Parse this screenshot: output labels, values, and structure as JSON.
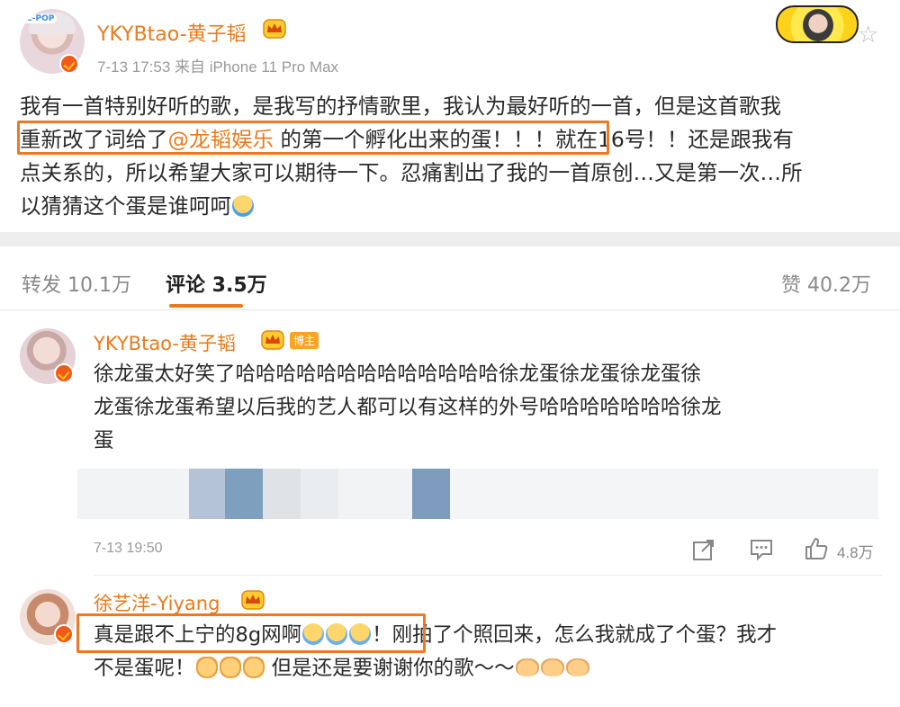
{
  "post": {
    "author": "YKYBtao-黄子韬",
    "meta": "7-13 17:53  来自 iPhone 11 Pro Max",
    "avatar_label": "C-POP",
    "lines": [
      "我有一首特别好听的歌，是我写的抒情歌里，我认为最好听的一首，但是这首歌我",
      "点关系的，所以希望大家可以期待一下。忍痛割出了我的一首原创…又是第一次…所",
      "以猜猜这个蛋是谁呵呵"
    ],
    "line2_before": "重新改了词给了",
    "line2_mention": "@龙韬娱乐",
    "line2_after": " 的第一个孵化出来的蛋！！！就在16号！！还是跟我有"
  },
  "tabs": {
    "repost": "转发 10.1万",
    "comments": "评论 3.5万",
    "likes": "赞 40.2万"
  },
  "comments": [
    {
      "author": "YKYBtao-黄子韬",
      "tag": "博主",
      "lines": [
        "徐龙蛋太好笑了哈哈哈哈哈哈哈哈哈哈哈哈哈徐龙蛋徐龙蛋徐龙蛋徐",
        "龙蛋徐龙蛋希望以后我的艺人都可以有这样的外号哈哈哈哈哈哈哈徐龙",
        "蛋"
      ],
      "time": "7-13 19:50",
      "likes": "4.8万"
    },
    {
      "author": "徐艺洋-Yiyang",
      "line1_a": "真是跟不上宁的8g网啊",
      "line1_b": "！刚拍了个照回来，怎么我就成了个蛋？我才",
      "line2_a": "不是蛋呢！",
      "line2_b": " 但是还是要谢谢你的歌～～"
    }
  ],
  "colors": {
    "accent": "#ea7a1b",
    "highlight_box": "#ee7922",
    "verified_badge": "#f25a1a"
  }
}
